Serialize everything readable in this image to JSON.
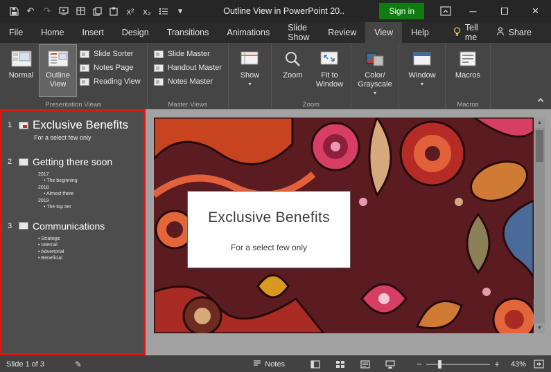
{
  "titlebar": {
    "title": "Outline View in PowerPoint 20..",
    "sign_in": "Sign in"
  },
  "glyphs": {
    "undo": "↶",
    "redo": "↷",
    "superscript": "x²",
    "subscript": "x₂",
    "caret": "▾",
    "close": "×",
    "minimize": "─",
    "minus": "−",
    "plus": "+",
    "up": "▲",
    "down": "▼",
    "pen": "✎"
  },
  "tabs": [
    {
      "label": "File"
    },
    {
      "label": "Home"
    },
    {
      "label": "Insert"
    },
    {
      "label": "Design"
    },
    {
      "label": "Transitions"
    },
    {
      "label": "Animations"
    },
    {
      "label": "Slide Show"
    },
    {
      "label": "Review"
    },
    {
      "label": "View"
    },
    {
      "label": "Help"
    }
  ],
  "tellme_label": "Tell me",
  "share_label": "Share",
  "ribbon": {
    "normal": "Normal",
    "outline_view": "Outline View",
    "slide_sorter": "Slide Sorter",
    "notes_page": "Notes Page",
    "reading_view": "Reading View",
    "presentation_views": "Presentation Views",
    "slide_master": "Slide Master",
    "handout_master": "Handout Master",
    "notes_master": "Notes Master",
    "master_views": "Master Views",
    "show": "Show",
    "zoom": "Zoom",
    "fit_to_window": "Fit to Window",
    "zoom_group": "Zoom",
    "color_line1": "Color/",
    "color_line2": "Grayscale",
    "window": "Window",
    "macros": "Macros",
    "macros_group": "Macros"
  },
  "outline": {
    "slides": [
      {
        "num": "1",
        "title": "Exclusive Benefits",
        "lines": [
          {
            "text": "For a select few only"
          }
        ]
      },
      {
        "num": "2",
        "title": "Getting there soon",
        "lines": [
          {
            "text": "2017"
          },
          {
            "text": "The beginning"
          },
          {
            "text": "2018"
          },
          {
            "text": "Almost there"
          },
          {
            "text": "2019"
          },
          {
            "text": "The top tier"
          }
        ]
      },
      {
        "num": "3",
        "title": "Communications",
        "lines": [
          {
            "text": "Strategic"
          },
          {
            "text": "Internal"
          },
          {
            "text": "Advertorial"
          },
          {
            "text": "Beneficial"
          }
        ]
      }
    ]
  },
  "slide": {
    "title": "Exclusive Benefits",
    "subtitle": "For a select few only"
  },
  "statusbar": {
    "slide_info": "Slide 1 of 3",
    "notes": "Notes",
    "zoom_level": "43%"
  },
  "colors": {
    "annotation_red": "#e01616",
    "sign_in_green": "#0f7c10",
    "slide_background": "#5a1c20"
  }
}
